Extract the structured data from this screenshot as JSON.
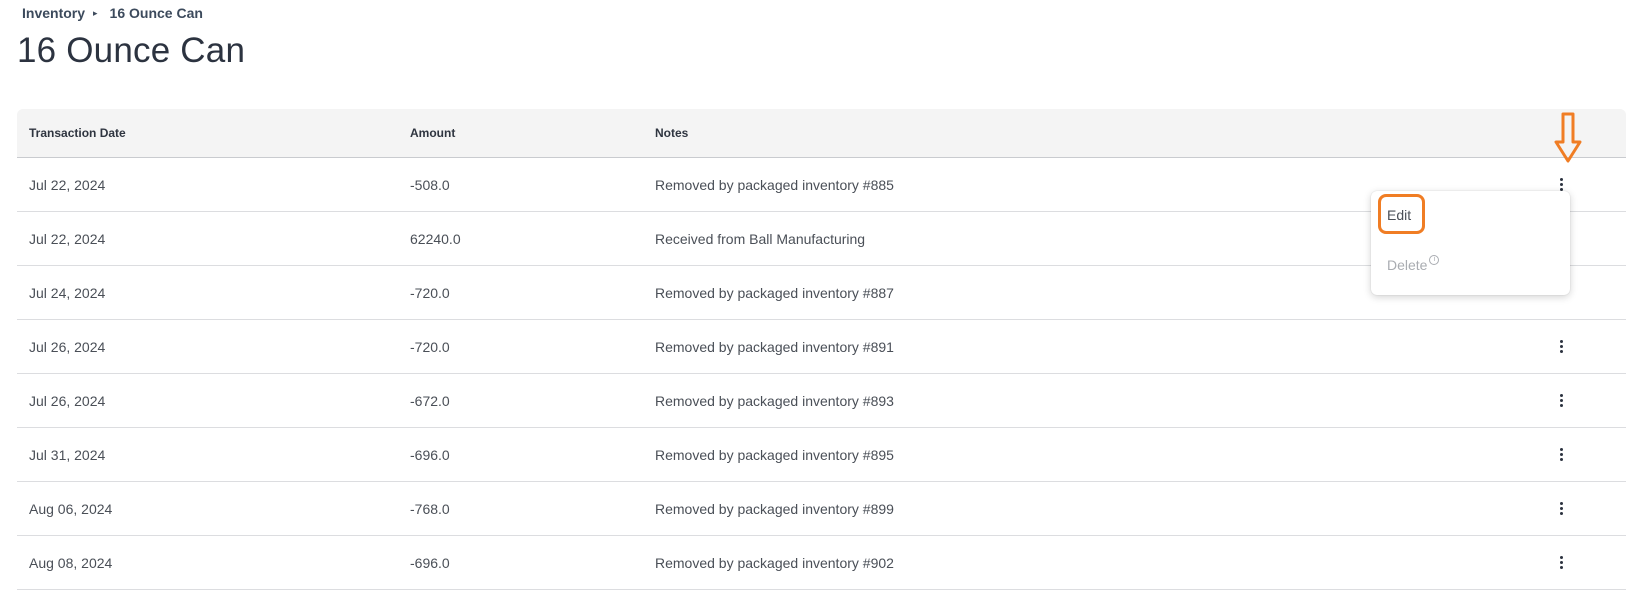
{
  "breadcrumb": {
    "parent": "Inventory",
    "separator": "▸",
    "current": "16 Ounce Can"
  },
  "page_title": "16 Ounce Can",
  "table": {
    "headers": [
      "Transaction Date",
      "Amount",
      "Notes"
    ],
    "rows": [
      {
        "date": "Jul 22, 2024",
        "amount": "-508.0",
        "notes": "Removed by packaged inventory #885"
      },
      {
        "date": "Jul 22, 2024",
        "amount": "62240.0",
        "notes": "Received from Ball Manufacturing"
      },
      {
        "date": "Jul 24, 2024",
        "amount": "-720.0",
        "notes": "Removed by packaged inventory #887"
      },
      {
        "date": "Jul 26, 2024",
        "amount": "-720.0",
        "notes": "Removed by packaged inventory #891"
      },
      {
        "date": "Jul 26, 2024",
        "amount": "-672.0",
        "notes": "Removed by packaged inventory #893"
      },
      {
        "date": "Jul 31, 2024",
        "amount": "-696.0",
        "notes": "Removed by packaged inventory #895"
      },
      {
        "date": "Aug 06, 2024",
        "amount": "-768.0",
        "notes": "Removed by packaged inventory #899"
      },
      {
        "date": "Aug 08, 2024",
        "amount": "-696.0",
        "notes": "Removed by packaged inventory #902"
      }
    ]
  },
  "row_menu": {
    "edit_label": "Edit",
    "delete_label": "Delete",
    "delete_info_icon": "info-icon"
  },
  "annotations": {
    "arrow_icon": "arrow-down-icon",
    "highlight_color": "#f07d24"
  }
}
